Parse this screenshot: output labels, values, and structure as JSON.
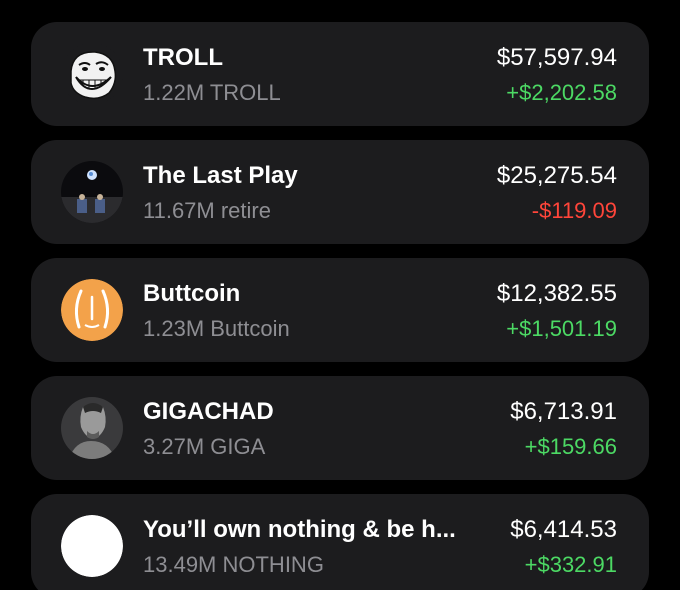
{
  "colors": {
    "background": "#000000",
    "card": "#1c1c1e",
    "primary_text": "#ffffff",
    "secondary_text": "#8e8e93",
    "positive": "#4cd964",
    "negative": "#ff453a"
  },
  "holdings": [
    {
      "icon": "troll-face-icon",
      "name": "TROLL",
      "amount": "1.22M TROLL",
      "value": "$57,597.94",
      "change": "+$2,202.58",
      "direction": "up"
    },
    {
      "icon": "last-play-icon",
      "name": "The Last Play",
      "amount": "11.67M retire",
      "value": "$25,275.54",
      "change": "-$119.09",
      "direction": "down"
    },
    {
      "icon": "buttcoin-icon",
      "name": "Buttcoin",
      "amount": "1.23M Buttcoin",
      "value": "$12,382.55",
      "change": "+$1,501.19",
      "direction": "up"
    },
    {
      "icon": "gigachad-icon",
      "name": "GIGACHAD",
      "amount": "3.27M GIGA",
      "value": "$6,713.91",
      "change": "+$159.66",
      "direction": "up"
    },
    {
      "icon": "white-circle-icon",
      "name": "You’ll own nothing & be h...",
      "amount": "13.49M NOTHING",
      "value": "$6,414.53",
      "change": "+$332.91",
      "direction": "up"
    }
  ]
}
